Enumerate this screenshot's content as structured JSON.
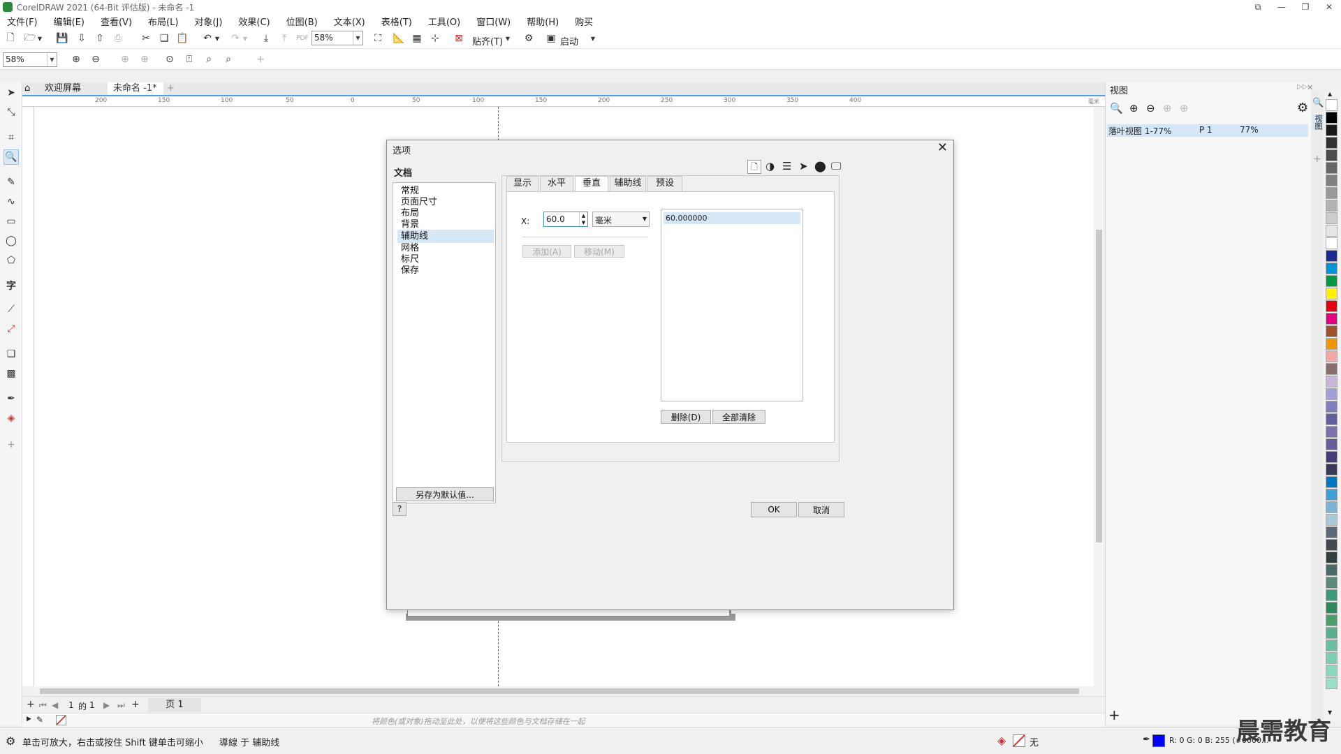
{
  "window": {
    "title": "CorelDRAW 2021 (64-Bit 评估版) - 未命名 -1"
  },
  "menu": [
    "文件(F)",
    "编辑(E)",
    "查看(V)",
    "布局(L)",
    "对象(J)",
    "效果(C)",
    "位图(B)",
    "文本(X)",
    "表格(T)",
    "工具(O)",
    "窗口(W)",
    "帮助(H)",
    "购买"
  ],
  "toolbar": {
    "zoom_value": "58%",
    "snap_label": "贴齐(T)",
    "launch_label": "启动"
  },
  "toolbar2": {
    "zoom_value": "58%"
  },
  "doc_tabs": {
    "welcome": "欢迎屏幕",
    "document": "未命名 -1*"
  },
  "ruler": {
    "h_labels": [
      "200",
      "150",
      "100",
      "50",
      "0",
      "50",
      "100",
      "150",
      "200",
      "250",
      "300",
      "350",
      "400"
    ],
    "units": "毫米"
  },
  "page_nav": {
    "current": "1",
    "of": "的",
    "total": "1",
    "page_tab": "页 1"
  },
  "color_hint": "将颜色(或对象)拖动至此处，以便将这些颜色与文档存储在一起",
  "status": {
    "hint": "单击可放大，右击或按住 Shift 键单击可缩小",
    "snap": "導線 于 辅助线",
    "fill_none": "无",
    "color_readout": "R: 0 G: 0 B: 255 (#0000..."
  },
  "docker": {
    "title": "视图",
    "item_name": "落叶视图 1-77%",
    "item_page": "P 1",
    "item_zoom": "77%",
    "side_tab": "视图"
  },
  "dialog": {
    "title": "选项",
    "section": "文档",
    "tree": [
      "常规",
      "页面尺寸",
      "布局",
      "背景",
      "辅助线",
      "网格",
      "标尺",
      "保存"
    ],
    "selected_tree_index": 4,
    "tabs": [
      "显示",
      "水平",
      "垂直",
      "辅助线",
      "预设"
    ],
    "active_tab": "垂直",
    "x_label": "X:",
    "x_value": "60.0",
    "unit": "毫米",
    "add_btn": "添加(A)",
    "move_btn": "移动(M)",
    "guides": [
      "60.000000"
    ],
    "delete_btn": "删除(D)",
    "clear_btn": "全部清除",
    "save_default": "另存为默认值...",
    "help_btn": "?",
    "ok_btn": "OK",
    "cancel_btn": "取消"
  },
  "watermark": "晨需教育",
  "colors": {
    "accent": "#4aa3df",
    "guide": "#d9364a",
    "selection": "#d5e6f7",
    "status_fill": "#0000ff"
  },
  "palette": [
    "#ffffff",
    "#000000",
    "#1a1a1a",
    "#333333",
    "#4d4d4d",
    "#666666",
    "#808080",
    "#999999",
    "#b3b3b3",
    "#cccccc",
    "#e6e6e6",
    "#ffffff",
    "#1c2b8f",
    "#0095d9",
    "#009944",
    "#fff100",
    "#e60012",
    "#e4007f",
    "#a0522d",
    "#f29600",
    "#f4a6a6",
    "#8b6d6d",
    "#c8b5d8",
    "#9fa0d7",
    "#7f7fbf",
    "#5f5fa0",
    "#8070b0",
    "#6a5a9a",
    "#4a3a7a",
    "#3a3a5a",
    "#0075c2",
    "#3da0d8",
    "#7ab4d6",
    "#a8c8d8",
    "#5a6a7a",
    "#404850",
    "#304040",
    "#4a6a6a",
    "#5a8a7a",
    "#3a9a7a",
    "#2a8a5a",
    "#4aa06a",
    "#5ab08a",
    "#6ac0a0",
    "#7ad0b0",
    "#8ad8c0",
    "#9ae0c8"
  ]
}
